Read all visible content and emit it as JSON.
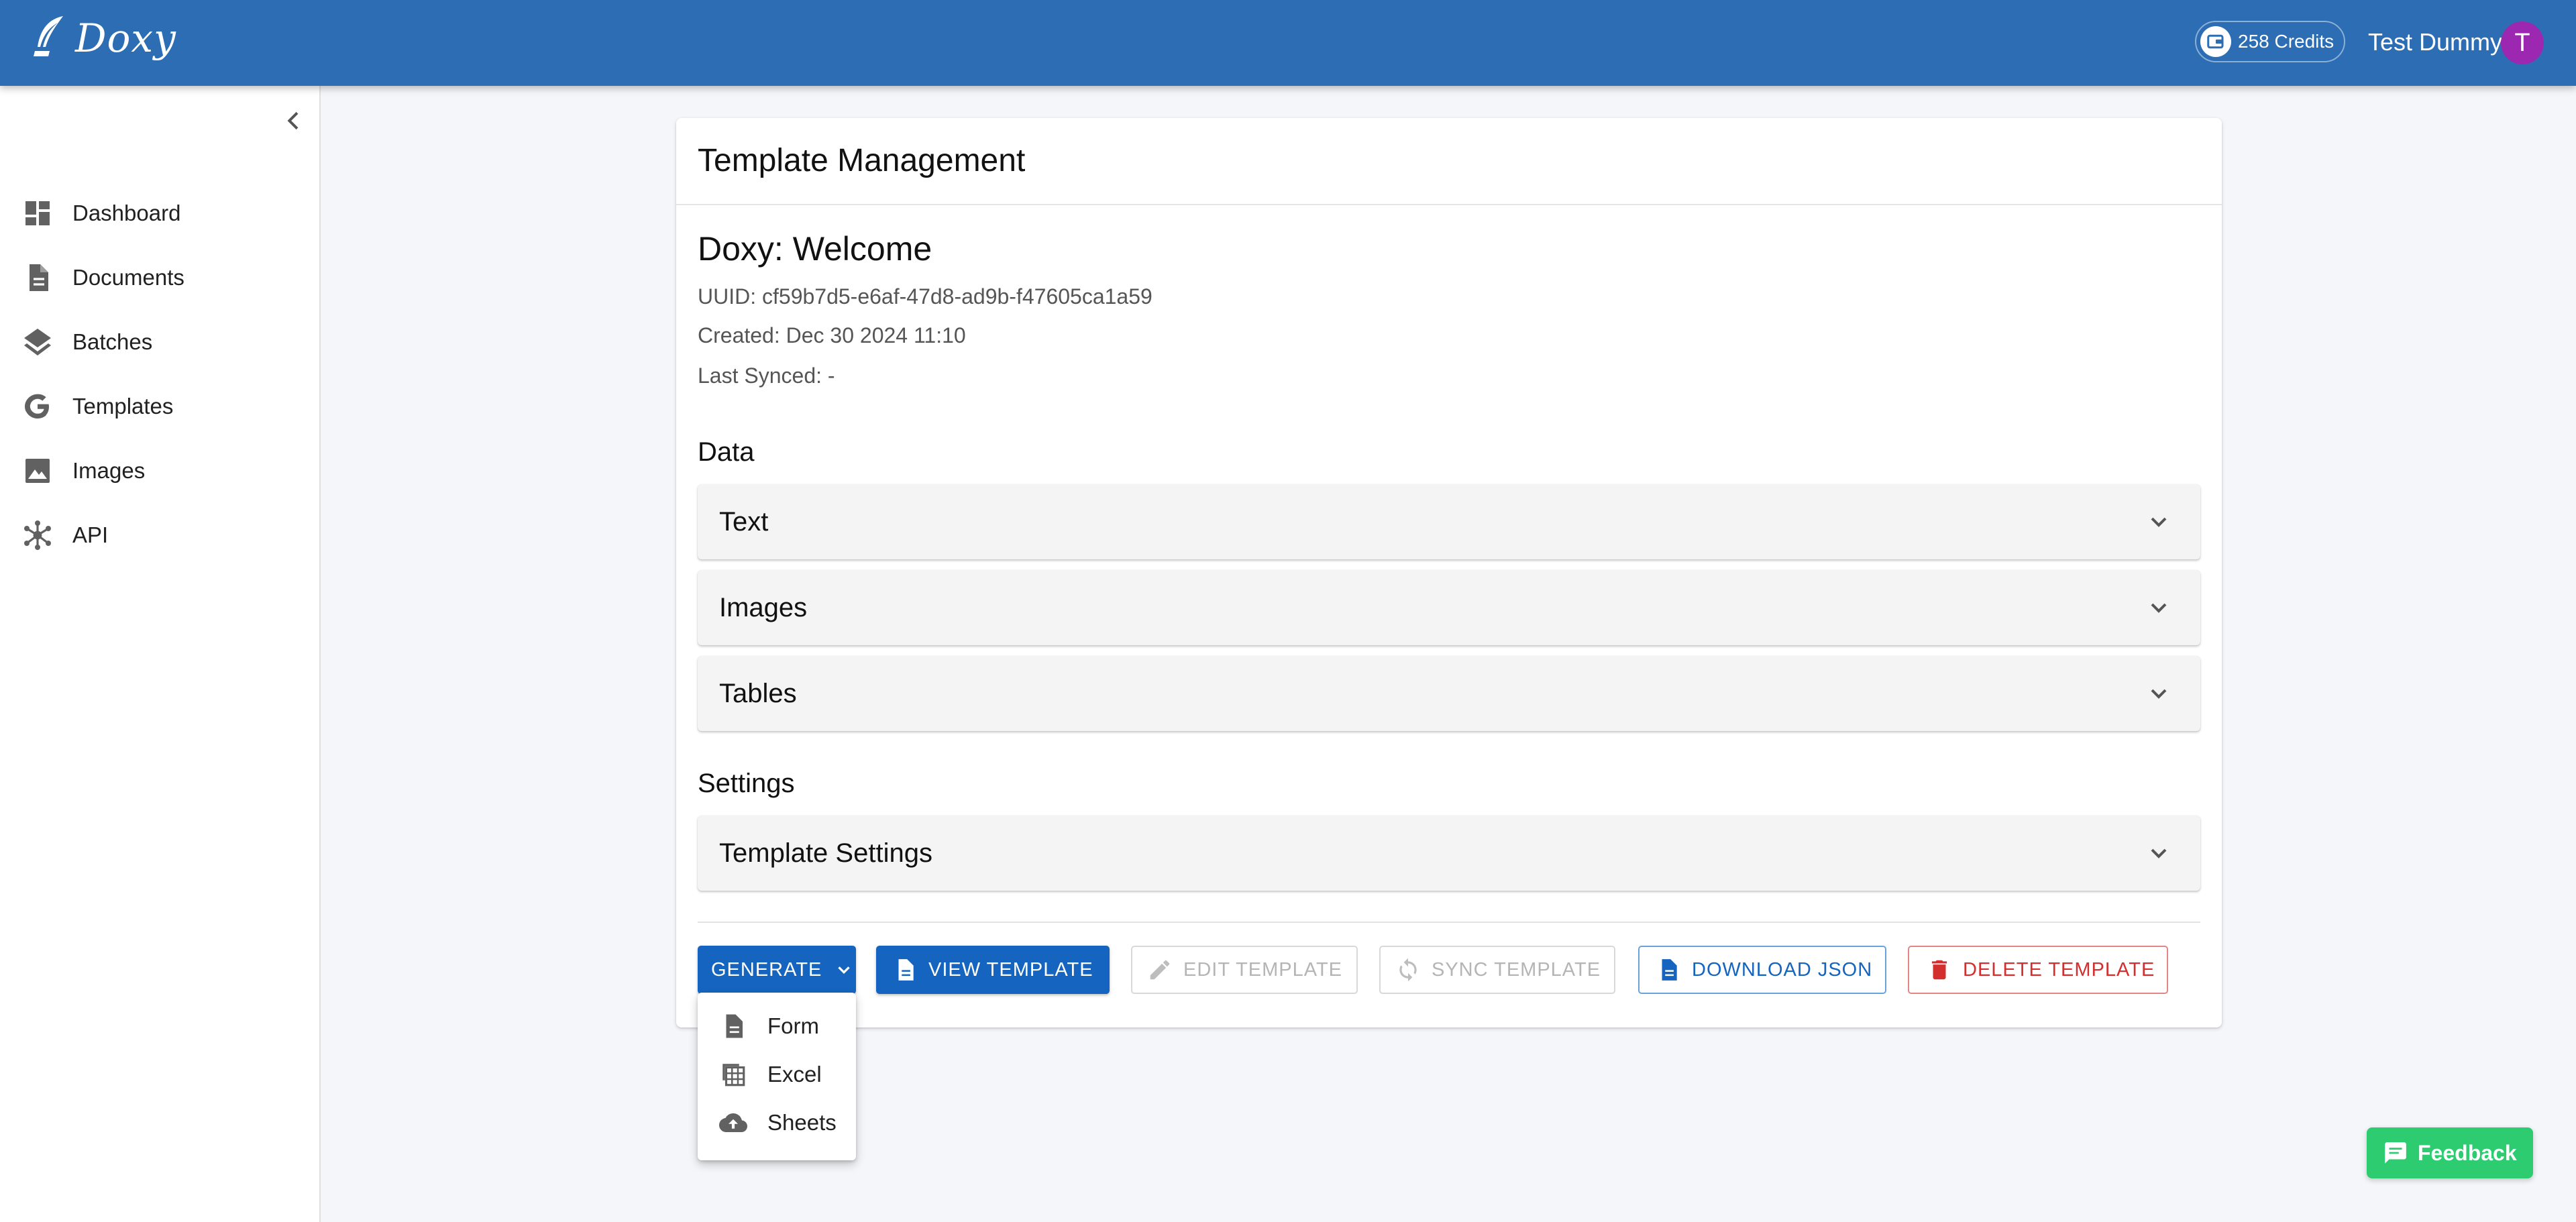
{
  "appbar": {
    "logo_text": "Doxy",
    "credits_label": "258 Credits",
    "user_name": "Test Dummy",
    "avatar_initial": "T"
  },
  "sidebar": {
    "items": [
      {
        "label": "Dashboard",
        "icon": "dashboard-icon"
      },
      {
        "label": "Documents",
        "icon": "document-icon"
      },
      {
        "label": "Batches",
        "icon": "layers-icon"
      },
      {
        "label": "Templates",
        "icon": "google-icon"
      },
      {
        "label": "Images",
        "icon": "image-icon"
      },
      {
        "label": "API",
        "icon": "hub-icon"
      }
    ]
  },
  "card": {
    "title": "Template Management",
    "template_name": "Doxy: Welcome",
    "uuid": "UUID: cf59b7d5-e6af-47d8-ad9b-f47605ca1a59",
    "created": "Created: Dec 30 2024 11:10",
    "last_synced": "Last Synced: -",
    "data_heading": "Data",
    "data_sections": [
      "Text",
      "Images",
      "Tables"
    ],
    "settings_heading": "Settings",
    "settings_sections": [
      "Template Settings"
    ]
  },
  "actions": {
    "generate": "GENERATE",
    "view": "VIEW TEMPLATE",
    "edit": "EDIT TEMPLATE",
    "sync": "SYNC TEMPLATE",
    "download": "DOWNLOAD JSON",
    "delete": "DELETE TEMPLATE"
  },
  "generate_menu": {
    "items": [
      {
        "label": "Form",
        "icon": "document-icon"
      },
      {
        "label": "Excel",
        "icon": "spreadsheet-icon"
      },
      {
        "label": "Sheets",
        "icon": "cloud-upload-icon"
      }
    ]
  },
  "feedback": {
    "label": "Feedback"
  },
  "colors": {
    "appbar": "#2c6db3",
    "primary": "#1565c0",
    "danger": "#d32f2f",
    "feedback": "#2ecc71",
    "avatar": "#9c27b0"
  }
}
